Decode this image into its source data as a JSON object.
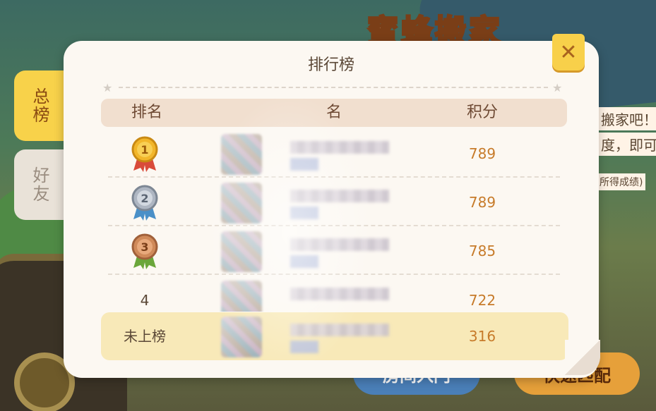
{
  "background": {
    "title": "蜜蜂搬家",
    "hint_lines": [
      "搬家吧！",
      "度，即可",
      "所得成绩)"
    ],
    "buttons": [
      "房间入门",
      "快速匹配"
    ]
  },
  "tabs": [
    {
      "label": "总榜",
      "active": true
    },
    {
      "label": "好友",
      "active": false
    }
  ],
  "panel": {
    "title": "排行榜",
    "close_label": "✕",
    "columns": {
      "rank": "排名",
      "name": "名",
      "score": "积分"
    }
  },
  "rows": [
    {
      "rank": "1",
      "medal": "gold",
      "score": "789"
    },
    {
      "rank": "2",
      "medal": "silver",
      "score": "789"
    },
    {
      "rank": "3",
      "medal": "bronze",
      "score": "785"
    },
    {
      "rank": "4",
      "medal": null,
      "score": "722"
    }
  ],
  "my_entry": {
    "rank": "未上榜",
    "score": "316"
  },
  "colors": {
    "gold": "#f2b62a",
    "silver": "#aeb6c2",
    "bronze": "#d08a5a",
    "score": "#c77b2a"
  }
}
